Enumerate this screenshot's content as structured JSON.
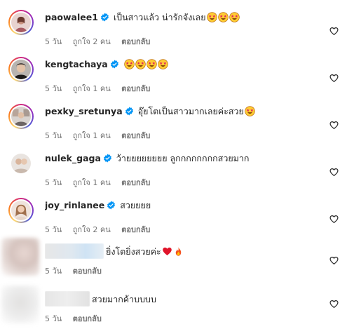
{
  "comments": [
    {
      "username": "paowalee1",
      "verified": true,
      "text": "เป็นสาวแล้ว น่ารักจังเลย",
      "emojis": [
        "star-struck-emoji",
        "star-struck-emoji",
        "star-struck-emoji"
      ],
      "time": "5 วัน",
      "likes": "ถูกใจ 2 คน",
      "reply": "ตอบกลับ"
    },
    {
      "username": "kengtachaya",
      "verified": true,
      "text": "",
      "emojis": [
        "star-struck-emoji",
        "star-struck-emoji",
        "star-struck-emoji",
        "star-struck-emoji"
      ],
      "time": "5 วัน",
      "likes": "ถูกใจ 1 คน",
      "reply": "ตอบกลับ"
    },
    {
      "username": "pexky_sretunya",
      "verified": true,
      "text": "อุ๊ยโตเป็นสาวมากเลยค่ะสวย",
      "emojis": [
        "star-struck-emoji"
      ],
      "time": "5 วัน",
      "likes": "ถูกใจ 1 คน",
      "reply": "ตอบกลับ"
    },
    {
      "username": "nulek_gaga",
      "verified": true,
      "text": "ว้ายยยยยยยย ลูกกกกกกกกสวยมาก",
      "emojis": [],
      "time": "5 วัน",
      "likes": "ถูกใจ 1 คน",
      "reply": "ตอบกลับ"
    },
    {
      "username": "joy_rinlanee",
      "verified": true,
      "text": "สวยยยย",
      "emojis": [],
      "time": "5 วัน",
      "likes": "ถูกใจ 2 คน",
      "reply": "ตอบกลับ"
    },
    {
      "username": "",
      "verified": false,
      "text": "ยิ่งโตยิ่งสวยค่ะ",
      "emojis": [
        "red-heart-emoji",
        "fire-emoji"
      ],
      "time": "5 วัน",
      "likes": "",
      "reply": "ตอบกลับ"
    },
    {
      "username": "",
      "verified": false,
      "text": "สวยมากค้าบบบบ",
      "emojis": [],
      "time": "5 วัน",
      "likes": "",
      "reply": "ตอบกลับ"
    }
  ],
  "colors": {
    "verified_blue": "#0095f6",
    "meta_gray": "#737373",
    "text_dark": "#262626"
  },
  "icons": {
    "like": "heart-outline-icon",
    "verified": "verified-badge-icon"
  }
}
